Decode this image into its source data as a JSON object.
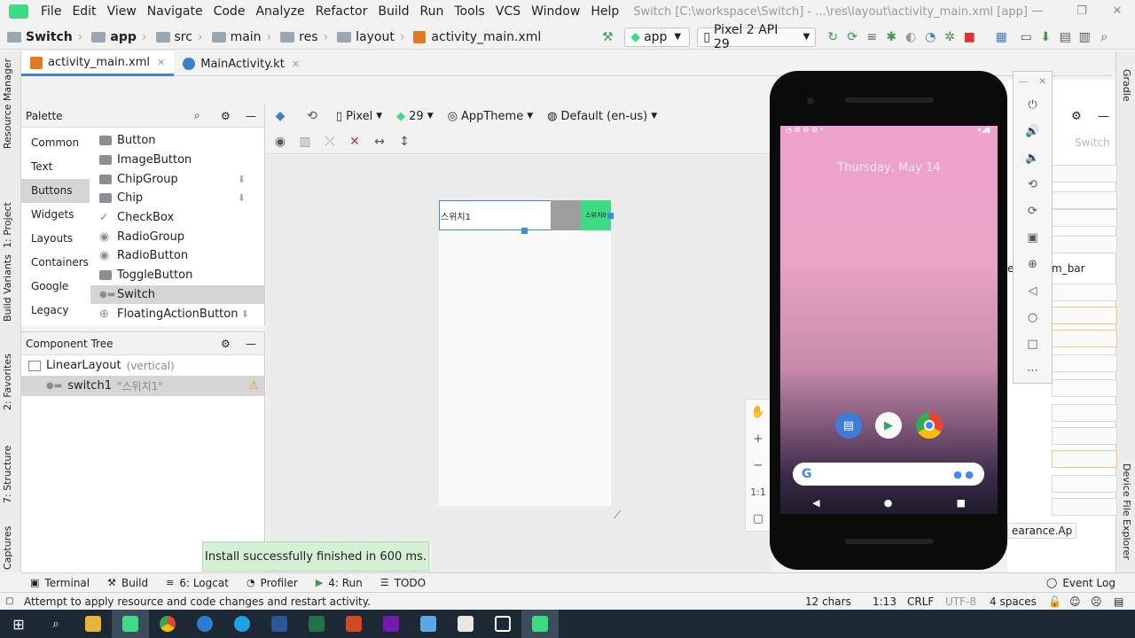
{
  "menu": {
    "items": [
      "File",
      "Edit",
      "View",
      "Navigate",
      "Code",
      "Analyze",
      "Refactor",
      "Build",
      "Run",
      "Tools",
      "VCS",
      "Window",
      "Help"
    ],
    "window_title": "Switch [C:\\workspace\\Switch] - ...\\res\\layout\\activity_main.xml [app]"
  },
  "nav": {
    "crumbs": [
      "Switch",
      "app",
      "src",
      "main",
      "res",
      "layout",
      "activity_main.xml"
    ],
    "run_config": "app",
    "device": "Pixel 2 API 29"
  },
  "tabs": [
    "activity_main.xml",
    "MainActivity.kt"
  ],
  "left_stripe": [
    "Resource Manager",
    "1: Project",
    "Build Variants",
    "2: Favorites",
    "7: Structure",
    "Captures"
  ],
  "right_stripe": [
    "Gradle",
    "Device File Explorer"
  ],
  "palette": {
    "title": "Palette",
    "categories": [
      "Common",
      "Text",
      "Buttons",
      "Widgets",
      "Layouts",
      "Containers",
      "Google",
      "Legacy"
    ],
    "selected_category": "Buttons",
    "widgets": [
      "Button",
      "ImageButton",
      "ChipGroup",
      "Chip",
      "CheckBox",
      "RadioGroup",
      "RadioButton",
      "ToggleButton",
      "Switch",
      "FloatingActionButton"
    ],
    "selected_widget": "Switch"
  },
  "tree": {
    "title": "Component Tree",
    "root": "LinearLayout",
    "root_hint": "(vertical)",
    "child": "switch1",
    "child_hint": "\"스위치1\""
  },
  "design": {
    "device": "Pixel",
    "api": "29",
    "theme": "AppTheme",
    "locale": "Default (en-us)",
    "switch_text": "스위치1",
    "switch_inner_text": "스위치0",
    "zoom_ratio": "1:1"
  },
  "attrs": {
    "hint_switch": "Switch",
    "frag1": "e",
    "frag2": "m_bar",
    "frag3": "earance.Ap"
  },
  "emulator": {
    "date": "Thursday, May 14"
  },
  "toast": "Install successfully finished in 600 ms.",
  "bottom_tools": [
    "Terminal",
    "Build",
    "6: Logcat",
    "Profiler",
    "4: Run",
    "TODO"
  ],
  "event_log": "Event Log",
  "status": {
    "message": "Attempt to apply resource and code changes and restart activity.",
    "chars": "12 chars",
    "position": "1:13",
    "line_sep": "CRLF",
    "encoding": "UTF-8",
    "indent": "4 spaces"
  },
  "colors": {
    "accent": "#4083c9",
    "android_green": "#3ddc84",
    "selection": "#d5d5d5"
  }
}
